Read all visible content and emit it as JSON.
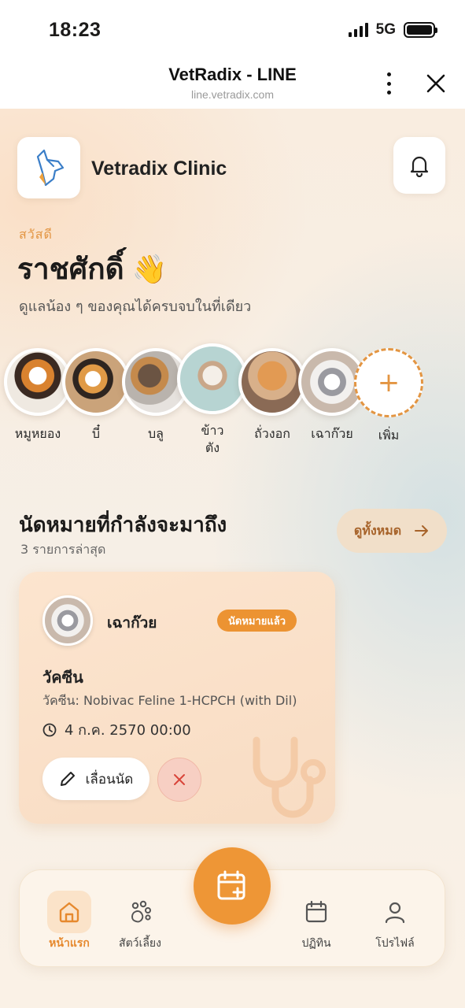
{
  "status_bar": {
    "time": "18:23",
    "network": "5G"
  },
  "browser": {
    "title": "VetRadix - LINE",
    "url": "line.vetradix.com"
  },
  "header": {
    "clinic_name": "Vetradix Clinic"
  },
  "greeting": {
    "hello": "สวัสดี",
    "name": "ราชศักดิ์",
    "emoji": "👋",
    "subtitle": "ดูแลน้อง ๆ ของคุณได้ครบจบในที่เดียว"
  },
  "pets": [
    {
      "name": "หมูหยอง"
    },
    {
      "name": "บี๋"
    },
    {
      "name": "บลู"
    },
    {
      "name": "ข้าว\nตัง"
    },
    {
      "name": "ถั่วงอก"
    },
    {
      "name": "เฉาก๊วย"
    }
  ],
  "add_pet": {
    "label": "เพิ่ม",
    "icon": "+"
  },
  "appointments": {
    "title": "นัดหมายที่กำลังจะมาถึง",
    "subtitle": "3 รายการล่าสุด",
    "view_all": "ดูทั้งหมด",
    "card": {
      "pet_name": "เฉาก๊วย",
      "status": "นัดหมายแล้ว",
      "type": "วัคซีน",
      "detail": "วัคซีน: Nobivac Feline 1-HCPCH (with Dil)",
      "datetime": "4 ก.ค. 2570 00:00",
      "reschedule_label": "เลื่อนนัด"
    }
  },
  "bottom_nav": {
    "home": "หน้าแรก",
    "pets": "สัตว์เลี้ยง",
    "calendar": "ปฏิทิน",
    "profile": "โปรไฟล์"
  },
  "colors": {
    "accent": "#ee9636",
    "accent_text": "#e39542",
    "badge": "#ec9332",
    "card_bg": "#fce5cf"
  }
}
